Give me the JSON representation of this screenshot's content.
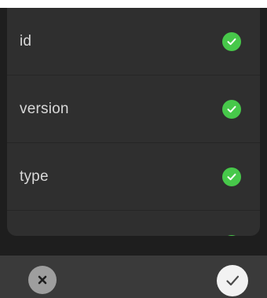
{
  "list": {
    "items": [
      {
        "label": "id",
        "selected": true,
        "icon": "check-circle-icon"
      },
      {
        "label": "version",
        "selected": true,
        "icon": "check-circle-icon"
      },
      {
        "label": "type",
        "selected": true,
        "icon": "check-circle-icon"
      },
      {
        "label": "",
        "selected": true,
        "icon": "check-circle-icon"
      }
    ]
  },
  "actions": {
    "cancel_icon": "close-icon",
    "confirm_icon": "checkmark-icon"
  },
  "colors": {
    "background": "#1e1e1e",
    "panel": "#2f2f2f",
    "text": "#d9d9d9",
    "accent_green": "#47c84a",
    "bottom_bar": "#3a3a3a",
    "cancel_button": "#9e9e9e",
    "confirm_button": "#f2f2f2"
  }
}
